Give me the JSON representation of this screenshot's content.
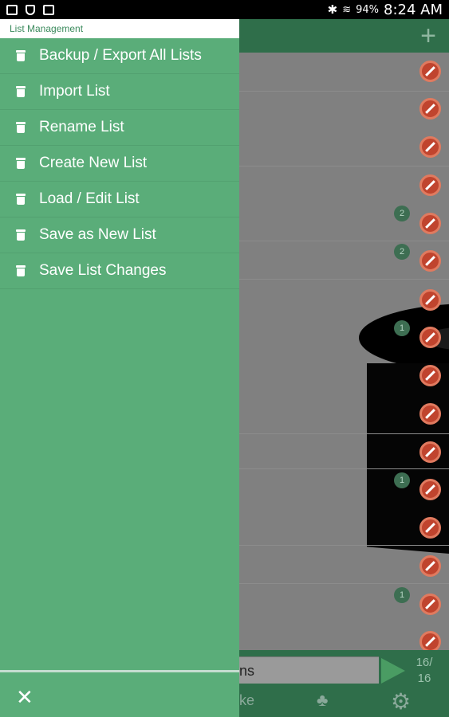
{
  "status_bar": {
    "battery": "94%",
    "time": "8:24 AM"
  },
  "drawer": {
    "title": "List Management",
    "items": [
      {
        "label": "Backup / Export All Lists"
      },
      {
        "label": "Import List"
      },
      {
        "label": "Rename List"
      },
      {
        "label": "Create New List"
      },
      {
        "label": "Load / Edit List"
      },
      {
        "label": "Save as New List"
      },
      {
        "label": "Save List Changes"
      }
    ],
    "close_icon": "close-icon"
  },
  "background": {
    "add_icon": "plus-icon",
    "badges": [
      "2",
      "2",
      "1",
      "1",
      "1"
    ],
    "search_text": "ns",
    "count_top": "16/",
    "count_bottom": "16",
    "bottom_label": "ke"
  }
}
